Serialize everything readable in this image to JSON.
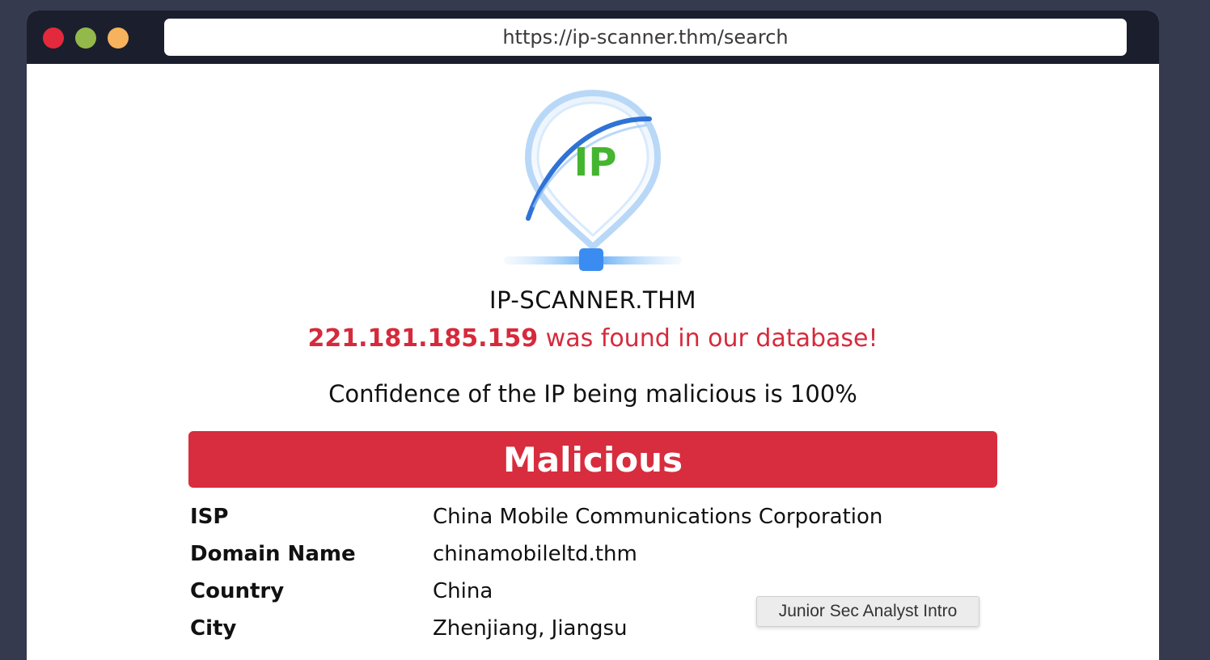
{
  "browser": {
    "url": "https://ip-scanner.thm/search"
  },
  "logo": {
    "text": "IP"
  },
  "site": {
    "name": "IP-SCANNER.THM"
  },
  "result": {
    "ip": "221.181.185.159",
    "found_text": " was found in our database!",
    "confidence_text": "Confidence of the IP being malicious is 100%",
    "verdict": "Malicious"
  },
  "details": [
    {
      "key": "ISP",
      "value": "China Mobile Communications Corporation"
    },
    {
      "key": "Domain Name",
      "value": "chinamobileltd.thm"
    },
    {
      "key": "Country",
      "value": "China"
    },
    {
      "key": "City",
      "value": "Zhenjiang, Jiangsu"
    }
  ],
  "tooltip": {
    "text": "Junior Sec Analyst Intro"
  },
  "colors": {
    "background": "#363a4f",
    "titlebar": "#1b1f2d",
    "malicious_red": "#d72d3e",
    "found_red": "#d62a3c",
    "logo_green": "#45b52f",
    "logo_blue": "#3b8cf0"
  }
}
